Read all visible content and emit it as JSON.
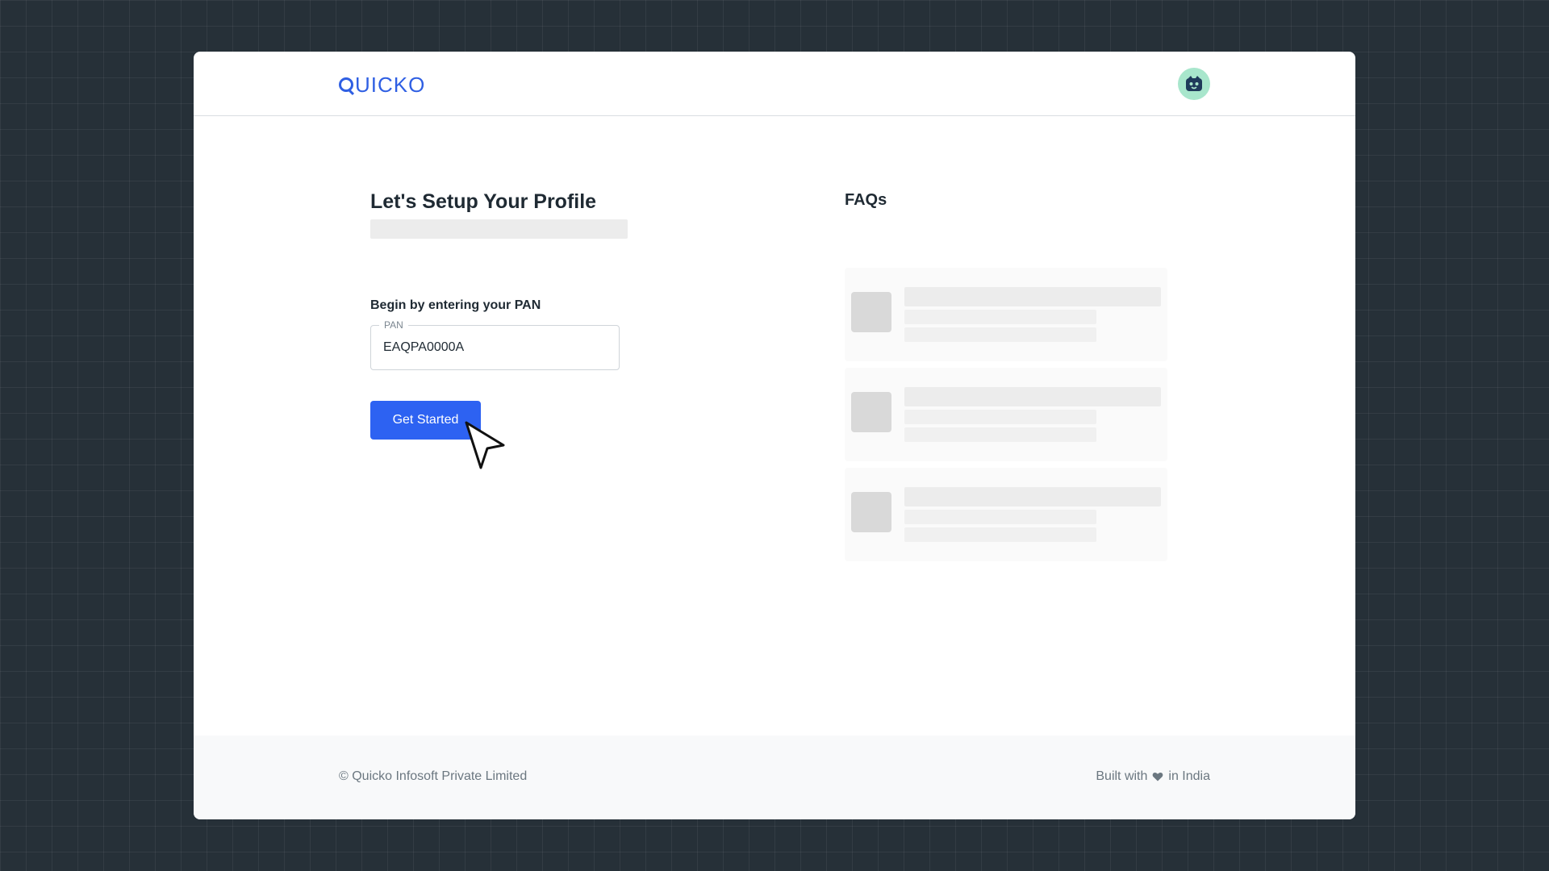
{
  "header": {
    "logo_text": "UICKO",
    "avatar_icon": "robot-face-icon"
  },
  "setup": {
    "title": "Let's Setup Your Profile",
    "pan_prompt": "Begin by entering your PAN",
    "pan_field": {
      "label": "PAN",
      "value": "EAQPA0000A"
    },
    "cta_label": "Get Started"
  },
  "faq": {
    "title": "FAQs",
    "items": [
      {
        "state": "loading"
      },
      {
        "state": "loading"
      },
      {
        "state": "loading"
      }
    ]
  },
  "footer": {
    "copyright": "© Quicko Infosoft Private Limited",
    "built_with": "Built with",
    "in_india": "in India",
    "heart_icon": "heart-icon"
  },
  "colors": {
    "brand": "#2f5fe3",
    "button": "#2d62f2",
    "avatar_bg": "#a8e6cc",
    "backdrop": "#263038"
  }
}
